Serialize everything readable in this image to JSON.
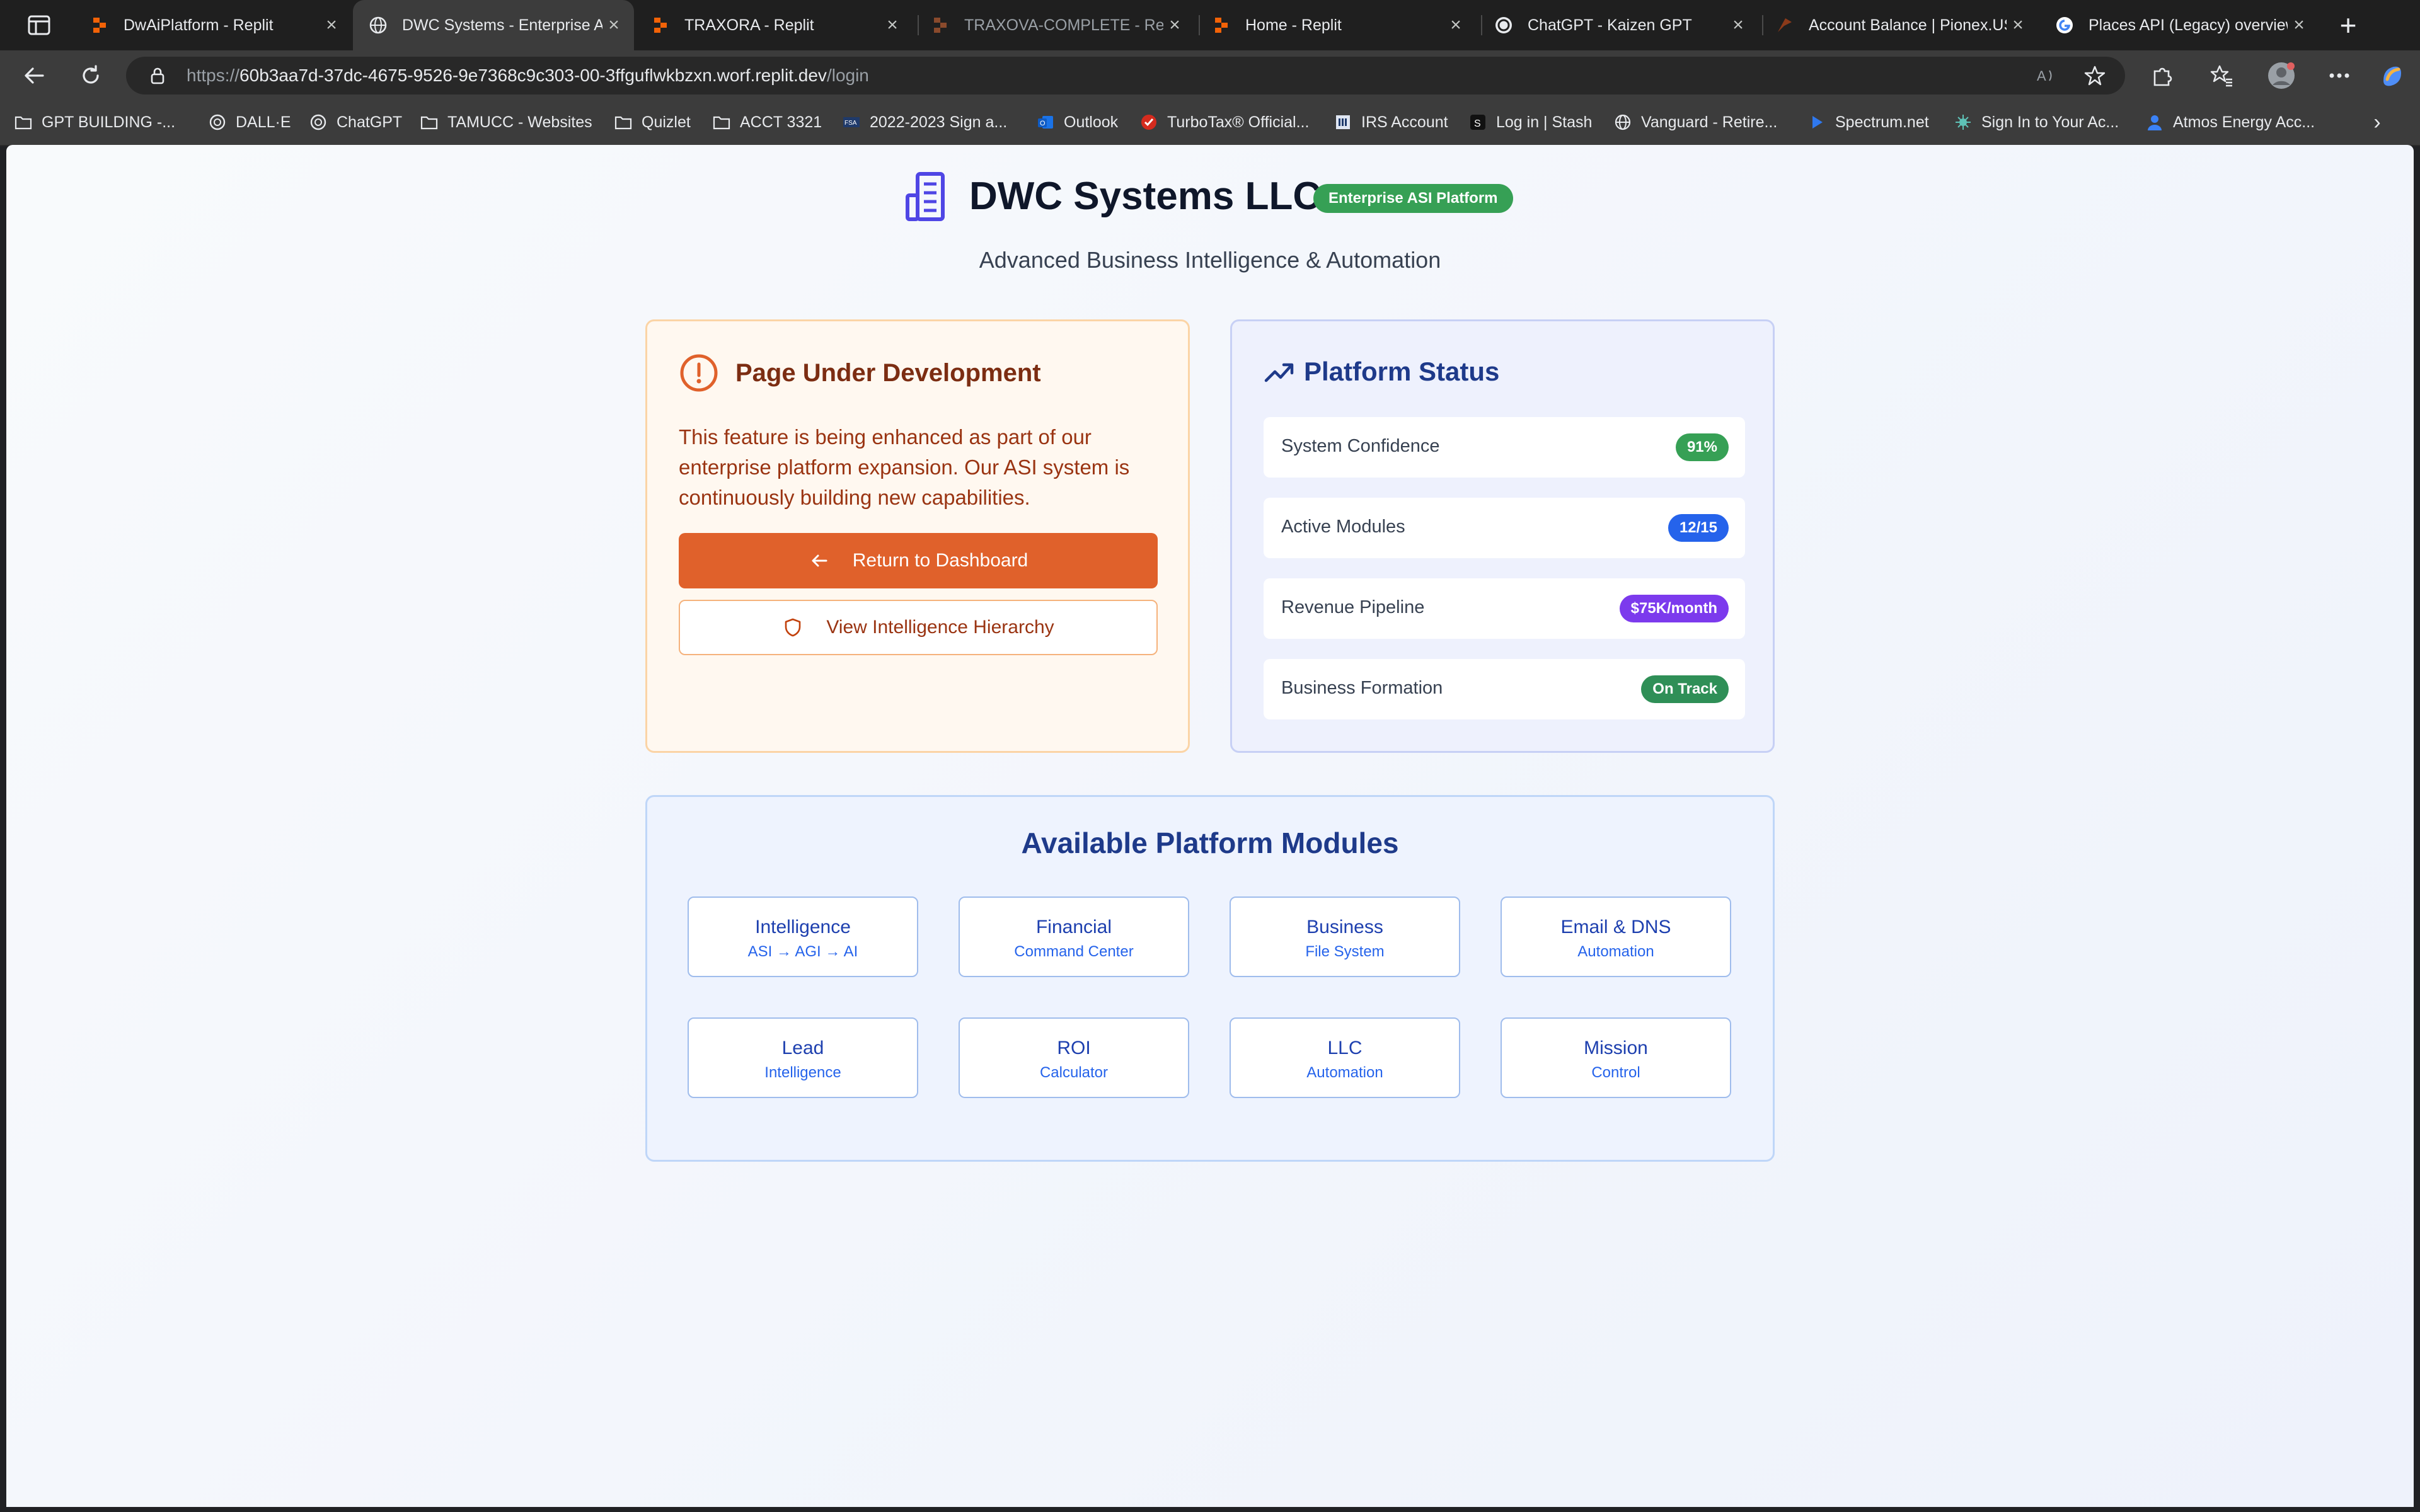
{
  "tabs": [
    {
      "label": "DwAiPlatform - Replit",
      "icon": "replit-icon",
      "active": false
    },
    {
      "label": "DWC Systems - Enterprise A",
      "icon": "globe-icon",
      "active": true
    },
    {
      "label": "TRAXORA - Replit",
      "icon": "replit-icon",
      "active": false
    },
    {
      "label": "TRAXOVA-COMPLETE - Rep",
      "icon": "replit-icon",
      "active": false
    },
    {
      "label": "Home - Replit",
      "icon": "replit-icon",
      "active": false
    },
    {
      "label": "ChatGPT - Kaizen GPT",
      "icon": "chatgpt-icon",
      "active": false
    },
    {
      "label": "Account Balance | Pionex.US",
      "icon": "pionex-icon",
      "active": false
    },
    {
      "label": "Places API (Legacy) overview",
      "icon": "google-icon",
      "active": false
    }
  ],
  "omnibox": {
    "url_prefix": "https://",
    "url_host": "60b3aa7d-37dc-4675-9526-9e7368c9c303-00-3ffguflwkbzxn.worf.replit.dev",
    "url_path": "/login"
  },
  "bookmarks": [
    {
      "label": "GPT BUILDING -...",
      "icon": "folder-icon"
    },
    {
      "label": "DALL·E",
      "icon": "openai-icon"
    },
    {
      "label": "ChatGPT",
      "icon": "openai-icon"
    },
    {
      "label": "TAMUCC - Websites",
      "icon": "folder-icon"
    },
    {
      "label": "Quizlet",
      "icon": "folder-icon"
    },
    {
      "label": "ACCT 3321",
      "icon": "folder-icon"
    },
    {
      "label": "2022-2023 Sign a...",
      "icon": "fsa-icon"
    },
    {
      "label": "Outlook",
      "icon": "outlook-icon"
    },
    {
      "label": "TurboTax® Official...",
      "icon": "turbotax-icon"
    },
    {
      "label": "IRS Account",
      "icon": "irs-icon"
    },
    {
      "label": "Log in | Stash",
      "icon": "stash-icon"
    },
    {
      "label": "Vanguard - Retire...",
      "icon": "globe-icon"
    },
    {
      "label": "Spectrum.net",
      "icon": "spectrum-icon"
    },
    {
      "label": "Sign In to Your Ac...",
      "icon": "sparkle-icon"
    },
    {
      "label": "Atmos Energy Acc...",
      "icon": "person-icon"
    }
  ],
  "header": {
    "brand": "DWC Systems LLC",
    "badge": "Enterprise ASI Platform",
    "tagline": "Advanced Business Intelligence & Automation"
  },
  "dev_card": {
    "title": "Page Under Development",
    "body": "This feature is being enhanced as part of our enterprise platform expansion. Our ASI system is continuously building new capabilities.",
    "primary_button": "Return to Dashboard",
    "secondary_button": "View Intelligence Hierarchy"
  },
  "status_card": {
    "title": "Platform Status",
    "rows": [
      {
        "label": "System Confidence",
        "value": "91%",
        "color": "#36a055"
      },
      {
        "label": "Active Modules",
        "value": "12/15",
        "color": "#2563eb"
      },
      {
        "label": "Revenue Pipeline",
        "value": "$75K/month",
        "color": "#7c3aed"
      },
      {
        "label": "Business Formation",
        "value": "On Track",
        "color": "#2f8f57"
      }
    ]
  },
  "modules": {
    "title": "Available Platform Modules",
    "items": [
      {
        "name": "Intelligence",
        "sub": "ASI → AGI → AI"
      },
      {
        "name": "Financial",
        "sub": "Command Center"
      },
      {
        "name": "Business",
        "sub": "File System"
      },
      {
        "name": "Email & DNS",
        "sub": "Automation"
      },
      {
        "name": "Lead",
        "sub": "Intelligence"
      },
      {
        "name": "ROI",
        "sub": "Calculator"
      },
      {
        "name": "LLC",
        "sub": "Automation"
      },
      {
        "name": "Mission",
        "sub": "Control"
      }
    ]
  },
  "colors": {
    "accent_orange": "#e0612b",
    "brand_blue": "#1e3a8a",
    "badge_green": "#36a055"
  }
}
